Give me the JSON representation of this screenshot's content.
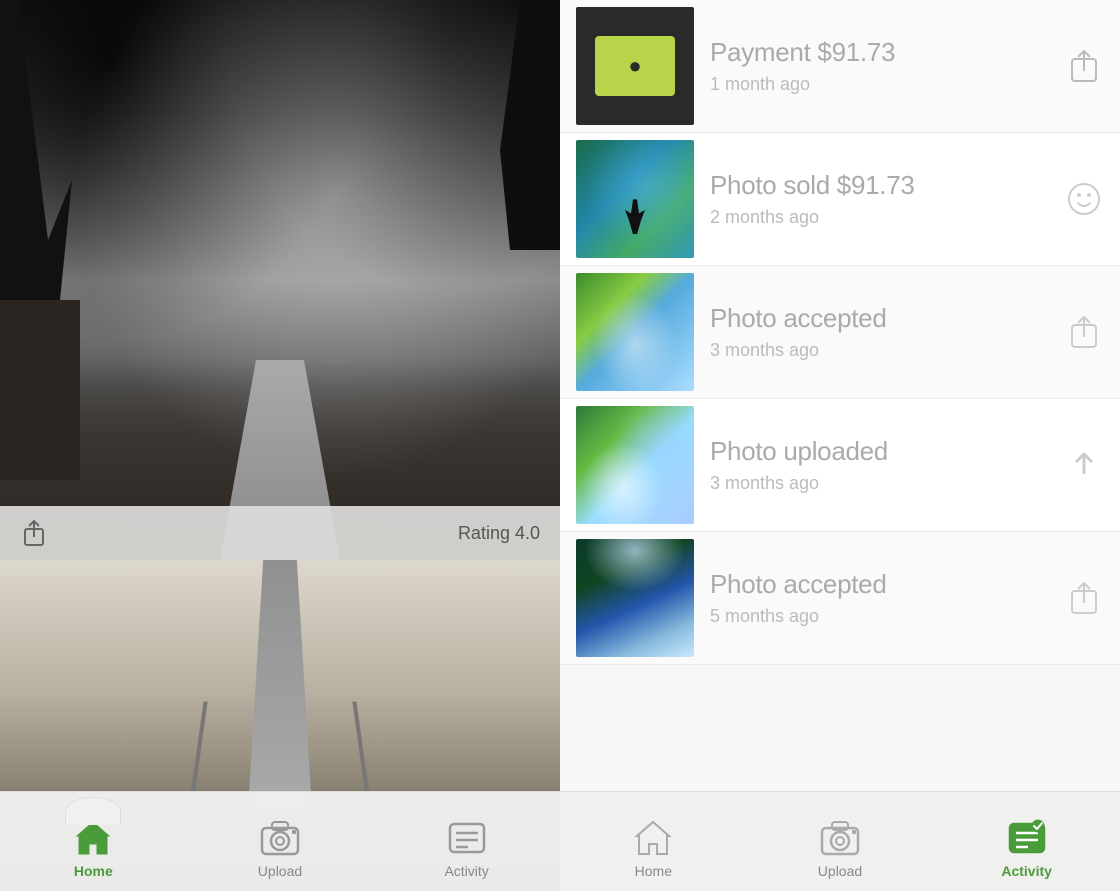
{
  "left_panel": {
    "photo_top": {
      "rating_label": "Rating 4.0"
    },
    "nav": {
      "items": [
        {
          "id": "home",
          "label": "Home",
          "active": true
        },
        {
          "id": "upload",
          "label": "Upload",
          "active": false
        },
        {
          "id": "activity",
          "label": "Activity",
          "active": false
        }
      ]
    }
  },
  "right_panel": {
    "activity_items": [
      {
        "type": "payment",
        "title": "Payment $91.73",
        "time": "1 month ago",
        "action": "share",
        "thumb_type": "payment"
      },
      {
        "type": "photo_sold",
        "title": "Photo sold $91.73",
        "time": "2 months ago",
        "action": "smiley",
        "thumb_type": "photo1"
      },
      {
        "type": "photo_accepted",
        "title": "Photo accepted",
        "time": "3 months ago",
        "action": "share",
        "thumb_type": "photo2"
      },
      {
        "type": "photo_uploaded",
        "title": "Photo uploaded",
        "time": "3 months ago",
        "action": "upload",
        "thumb_type": "photo3"
      },
      {
        "type": "photo_accepted2",
        "title": "Photo accepted",
        "time": "5 months ago",
        "action": "share",
        "thumb_type": "photo4"
      }
    ],
    "nav": {
      "items": [
        {
          "id": "home",
          "label": "Home",
          "active": false
        },
        {
          "id": "upload",
          "label": "Upload",
          "active": false
        },
        {
          "id": "activity",
          "label": "Activity",
          "active": true
        }
      ]
    }
  }
}
